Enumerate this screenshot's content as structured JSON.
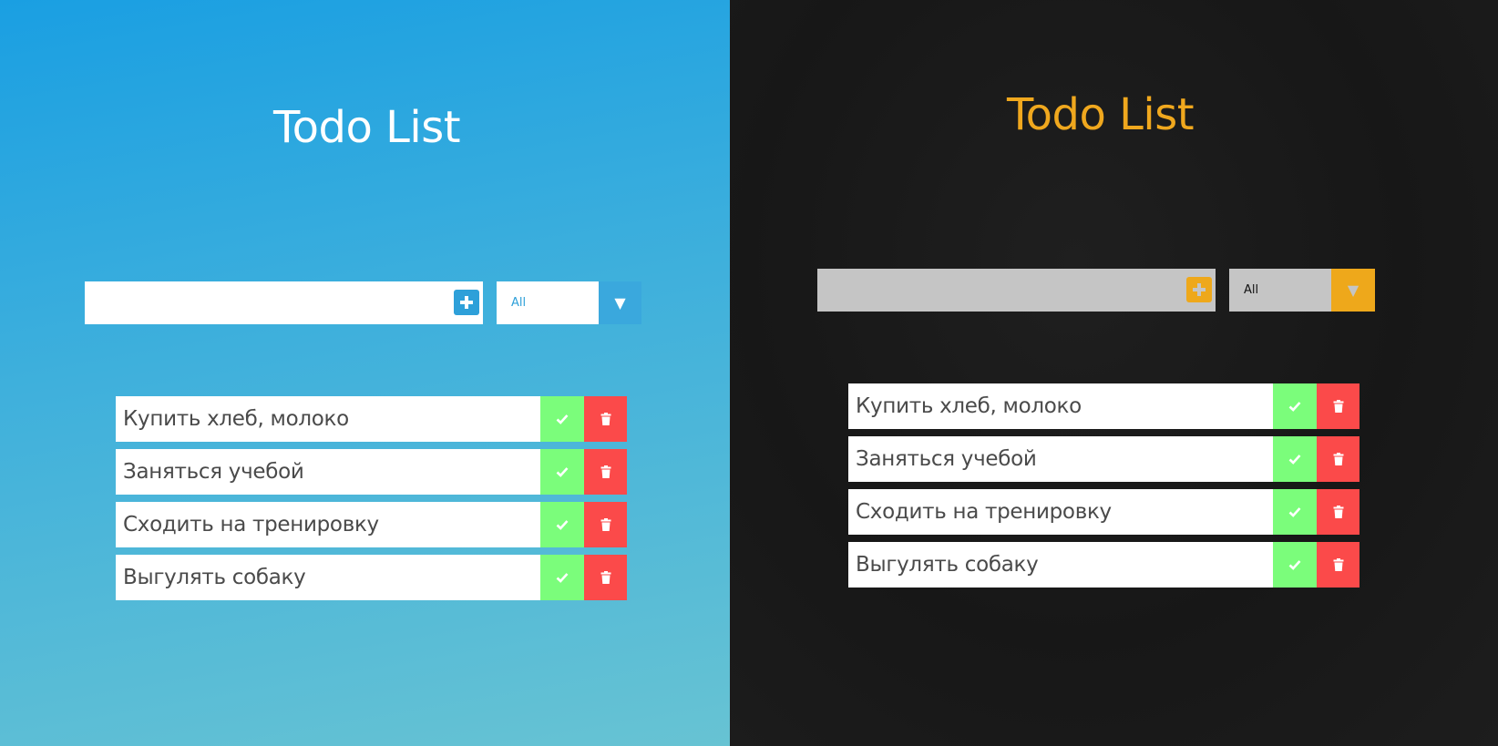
{
  "colors": {
    "light_bg_top": "#1a9fe2",
    "light_bg_bottom": "#67c3d3",
    "dark_bg": "#1a1a1a",
    "dark_accent": "#f0a81e",
    "done_green": "#7bfd7b",
    "delete_red": "#fb4a4a"
  },
  "light": {
    "title": "Todo List",
    "input": {
      "value": "",
      "placeholder": ""
    },
    "add_icon": "plus-square-icon",
    "filter": {
      "selected": "All",
      "arrow": "▼"
    },
    "todos": [
      {
        "text": "Купить хлеб, молоко"
      },
      {
        "text": "Заняться учебой"
      },
      {
        "text": "Сходить на тренировку"
      },
      {
        "text": "Выгулять собаку"
      }
    ]
  },
  "dark": {
    "title": "Todo List",
    "input": {
      "value": "",
      "placeholder": ""
    },
    "add_icon": "plus-square-icon",
    "filter": {
      "selected": "All",
      "arrow": "▼"
    },
    "todos": [
      {
        "text": "Купить хлеб, молоко"
      },
      {
        "text": "Заняться учебой"
      },
      {
        "text": "Сходить на тренировку"
      },
      {
        "text": "Выгулять собаку"
      }
    ]
  }
}
